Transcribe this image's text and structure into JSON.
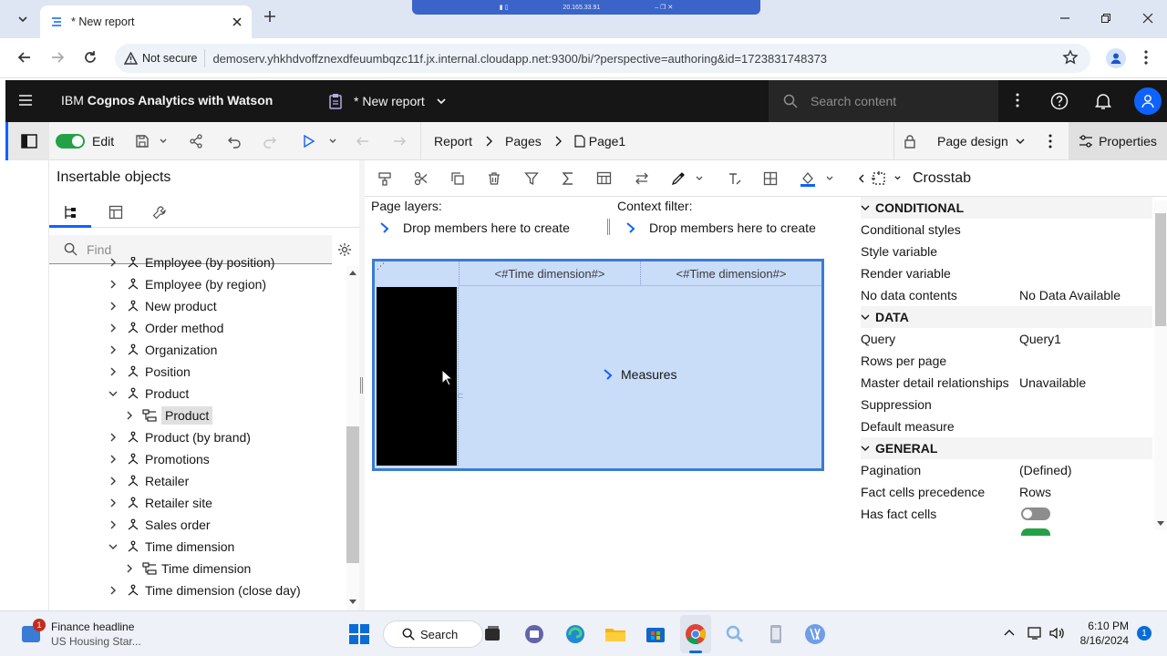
{
  "browser": {
    "tab_title": "* New report",
    "remote_ip": "20.165.33.91",
    "not_secure_label": "Not secure",
    "url": "demoserv.yhkhdvoffznexdfeuumbqzc11f.jx.internal.cloudapp.net:9300/bi/?perspective=authoring&id=1723831748373"
  },
  "header": {
    "product_prefix": "IBM ",
    "product_name": "Cognos Analytics with Watson",
    "report_name": "* New report",
    "search_placeholder": "Search content"
  },
  "toolbar": {
    "edit_label": "Edit",
    "breadcrumb": [
      "Report",
      "Pages",
      "Page1"
    ],
    "page_design_label": "Page design",
    "properties_label": "Properties",
    "crosstab_label": "Crosstab"
  },
  "insertable": {
    "title": "Insertable objects",
    "find_placeholder": "Find",
    "tree": [
      {
        "label": "Employee (by position)",
        "level": 0,
        "expanded": false,
        "type": "dimension"
      },
      {
        "label": "Employee (by region)",
        "level": 0,
        "expanded": false,
        "type": "dimension"
      },
      {
        "label": "New product",
        "level": 0,
        "expanded": false,
        "type": "dimension"
      },
      {
        "label": "Order method",
        "level": 0,
        "expanded": false,
        "type": "dimension"
      },
      {
        "label": "Organization",
        "level": 0,
        "expanded": false,
        "type": "dimension"
      },
      {
        "label": "Position",
        "level": 0,
        "expanded": false,
        "type": "dimension"
      },
      {
        "label": "Product",
        "level": 0,
        "expanded": true,
        "type": "dimension"
      },
      {
        "label": "Product",
        "level": 1,
        "expanded": false,
        "type": "hierarchy",
        "selected": true
      },
      {
        "label": "Product (by brand)",
        "level": 0,
        "expanded": false,
        "type": "dimension"
      },
      {
        "label": "Promotions",
        "level": 0,
        "expanded": false,
        "type": "dimension"
      },
      {
        "label": "Retailer",
        "level": 0,
        "expanded": false,
        "type": "dimension"
      },
      {
        "label": "Retailer site",
        "level": 0,
        "expanded": false,
        "type": "dimension"
      },
      {
        "label": "Sales order",
        "level": 0,
        "expanded": false,
        "type": "dimension"
      },
      {
        "label": "Time dimension",
        "level": 0,
        "expanded": true,
        "type": "dimension"
      },
      {
        "label": "Time dimension",
        "level": 1,
        "expanded": false,
        "type": "hierarchy"
      },
      {
        "label": "Time dimension (close day)",
        "level": 0,
        "expanded": false,
        "type": "dimension"
      }
    ]
  },
  "canvas": {
    "page_layers_label": "Page layers:",
    "context_filter_label": "Context filter:",
    "drop_text": "Drop members here to create",
    "col_header_1": "<#Time dimension#>",
    "col_header_2": "<#Time dimension#>",
    "measures_label": "Measures"
  },
  "properties": {
    "sections": [
      {
        "title": "CONDITIONAL",
        "rows": [
          {
            "key": "Conditional styles",
            "value": ""
          },
          {
            "key": "Style variable",
            "value": ""
          },
          {
            "key": "Render variable",
            "value": ""
          },
          {
            "key": "No data contents",
            "value": "No Data Available"
          }
        ]
      },
      {
        "title": "DATA",
        "rows": [
          {
            "key": "Query",
            "value": "Query1"
          },
          {
            "key": "Rows per page",
            "value": ""
          },
          {
            "key": "Master detail relationships",
            "value": "Unavailable"
          },
          {
            "key": "Suppression",
            "value": ""
          },
          {
            "key": "Default measure",
            "value": ""
          }
        ]
      },
      {
        "title": "GENERAL",
        "rows": [
          {
            "key": "Pagination",
            "value": "(Defined)"
          },
          {
            "key": "Fact cells precedence",
            "value": "Rows"
          },
          {
            "key": "Has fact cells",
            "value": ""
          }
        ]
      }
    ]
  },
  "taskbar": {
    "news_title": "Finance headline",
    "news_sub": "US Housing Star...",
    "news_badge": "1",
    "search_label": "Search",
    "time": "6:10 PM",
    "date": "8/16/2024",
    "notif_count": "1"
  },
  "colors": {
    "accent": "#0f62fe",
    "crosstab_fill": "#c9dcf8",
    "crosstab_border": "#3a7bd5",
    "toggle_on": "#24a148"
  }
}
